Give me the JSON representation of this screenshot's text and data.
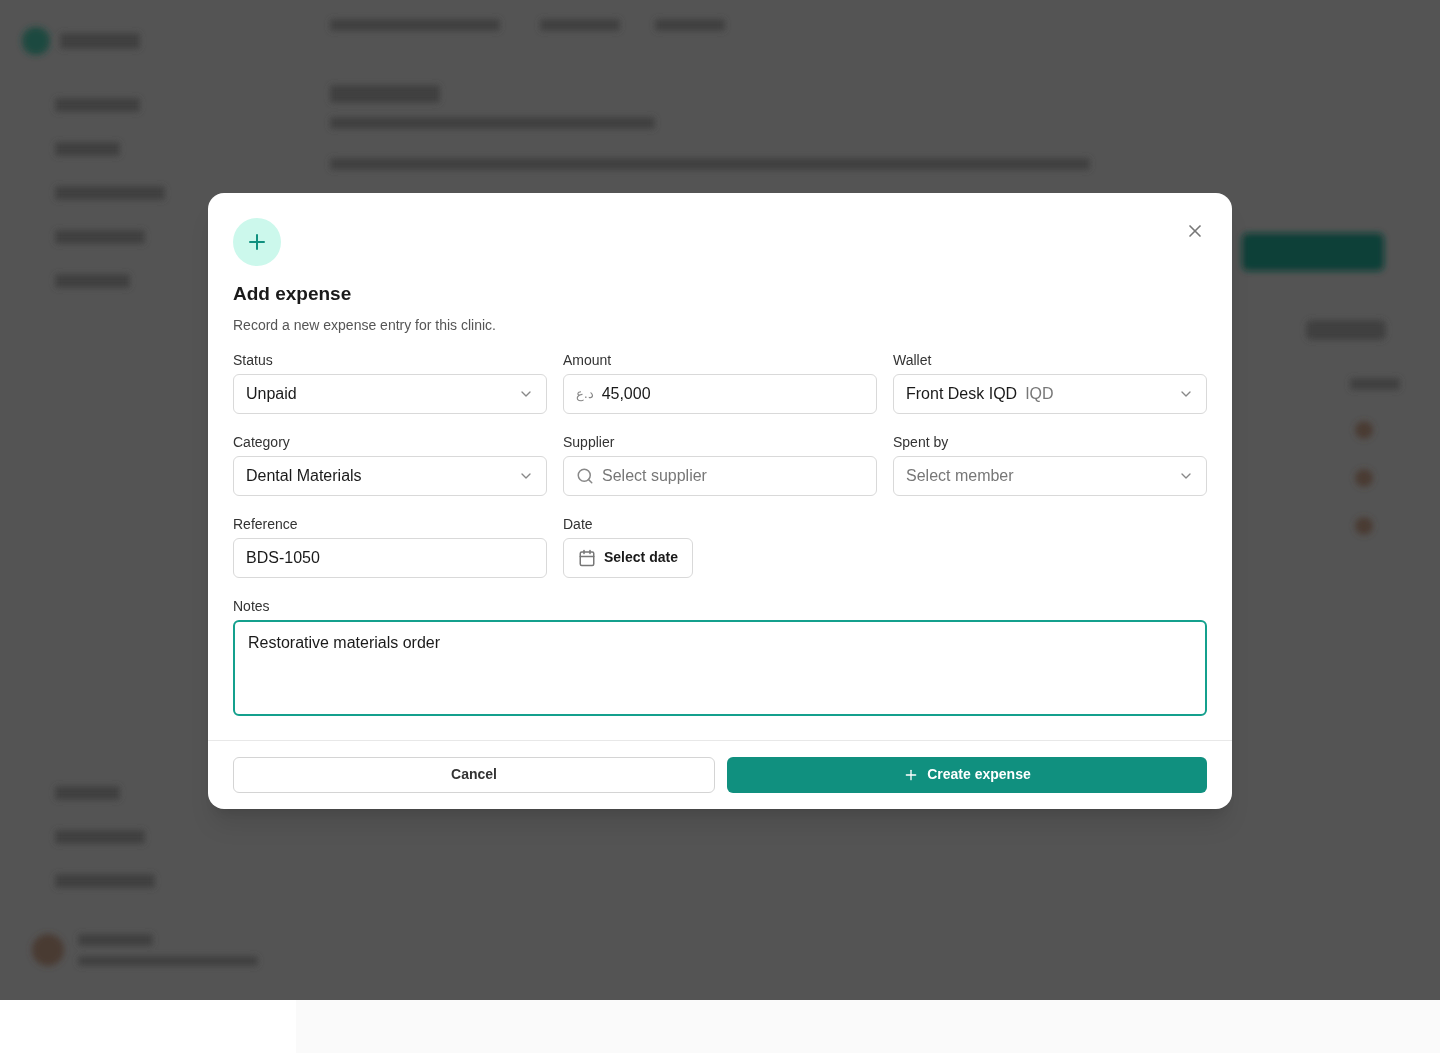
{
  "dialog": {
    "title": "Add expense",
    "description": "Record a new expense entry for this clinic.",
    "fields": [
      {
        "kind": "select",
        "label": "Status",
        "value": "Unpaid"
      },
      {
        "kind": "amount",
        "label": "Amount",
        "prefix": "د.ع",
        "value": "45,000"
      },
      {
        "kind": "select",
        "label": "Wallet",
        "value": "Front Desk IQD",
        "suffix": "IQD"
      },
      {
        "kind": "select",
        "label": "Category",
        "value": "Dental Materials"
      },
      {
        "kind": "search",
        "label": "Supplier",
        "placeholder": "Select supplier"
      },
      {
        "kind": "select",
        "label": "Spent by",
        "placeholder": "Select member"
      },
      {
        "kind": "text",
        "label": "Reference",
        "value": "BDS-1050"
      },
      {
        "kind": "date",
        "label": "Date",
        "button": "Select date"
      }
    ],
    "notes": {
      "label": "Notes",
      "value": "Restorative materials order",
      "focused": true
    },
    "buttons": [
      {
        "kind": "secondary",
        "label": "Cancel"
      },
      {
        "kind": "primary",
        "label": "Create expense"
      }
    ]
  }
}
